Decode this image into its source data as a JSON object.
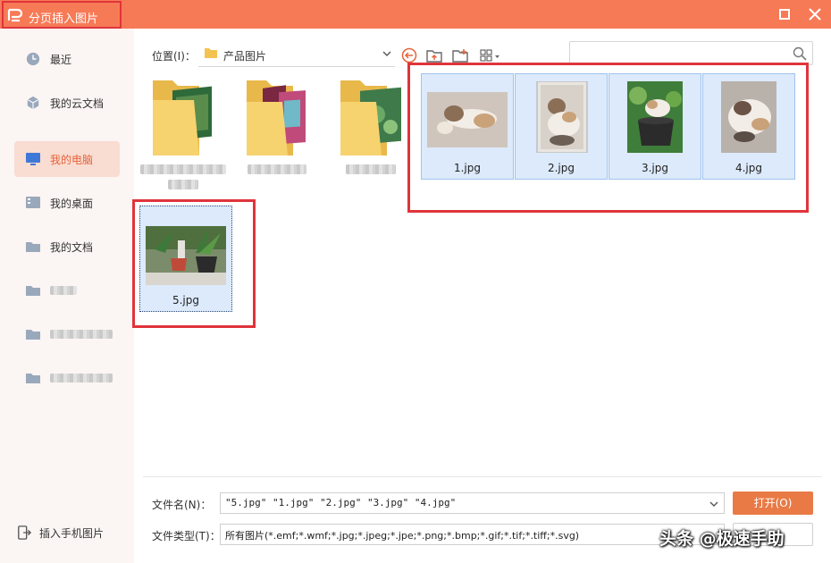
{
  "window": {
    "title": "分页插入图片",
    "accent_color": "#f77a57",
    "highlight_color": "#e0343b"
  },
  "sidebar": {
    "items": [
      {
        "label": "最近",
        "icon": "clock-icon"
      },
      {
        "label": "我的云文档",
        "icon": "cloud-cube-icon"
      },
      {
        "label": "我的电脑",
        "icon": "monitor-icon",
        "active": true
      },
      {
        "label": "我的桌面",
        "icon": "desktop-icon"
      },
      {
        "label": "我的文档",
        "icon": "folder-icon"
      }
    ],
    "blurred_folders": 3,
    "phone_button": "插入手机图片"
  },
  "toolbar": {
    "location_label": "位置(I)：",
    "current_path": "产品图片",
    "icons": [
      "back-icon",
      "up-folder-icon",
      "new-folder-icon",
      "view-mode-icon"
    ],
    "search_placeholder": ""
  },
  "files": {
    "folders_blurred": 3,
    "images": [
      {
        "name": "1.jpg",
        "subject": "cat lying"
      },
      {
        "name": "2.jpg",
        "subject": "cat in frame"
      },
      {
        "name": "3.jpg",
        "subject": "cat in pot"
      },
      {
        "name": "4.jpg",
        "subject": "cat curled"
      },
      {
        "name": "5.jpg",
        "subject": "potted plants",
        "focused": true
      }
    ]
  },
  "footer": {
    "filename_label": "文件名(N)：",
    "filename_value": "\"5.jpg\" \"1.jpg\" \"2.jpg\" \"3.jpg\" \"4.jpg\"",
    "filetype_label": "文件类型(T)：",
    "filetype_value": "所有图片(*.emf;*.wmf;*.jpg;*.jpeg;*.jpe;*.png;*.bmp;*.gif;*.tif;*.tiff;*.svg)",
    "open_button": "打开(O)",
    "watermark": "头条 @极速手助"
  }
}
